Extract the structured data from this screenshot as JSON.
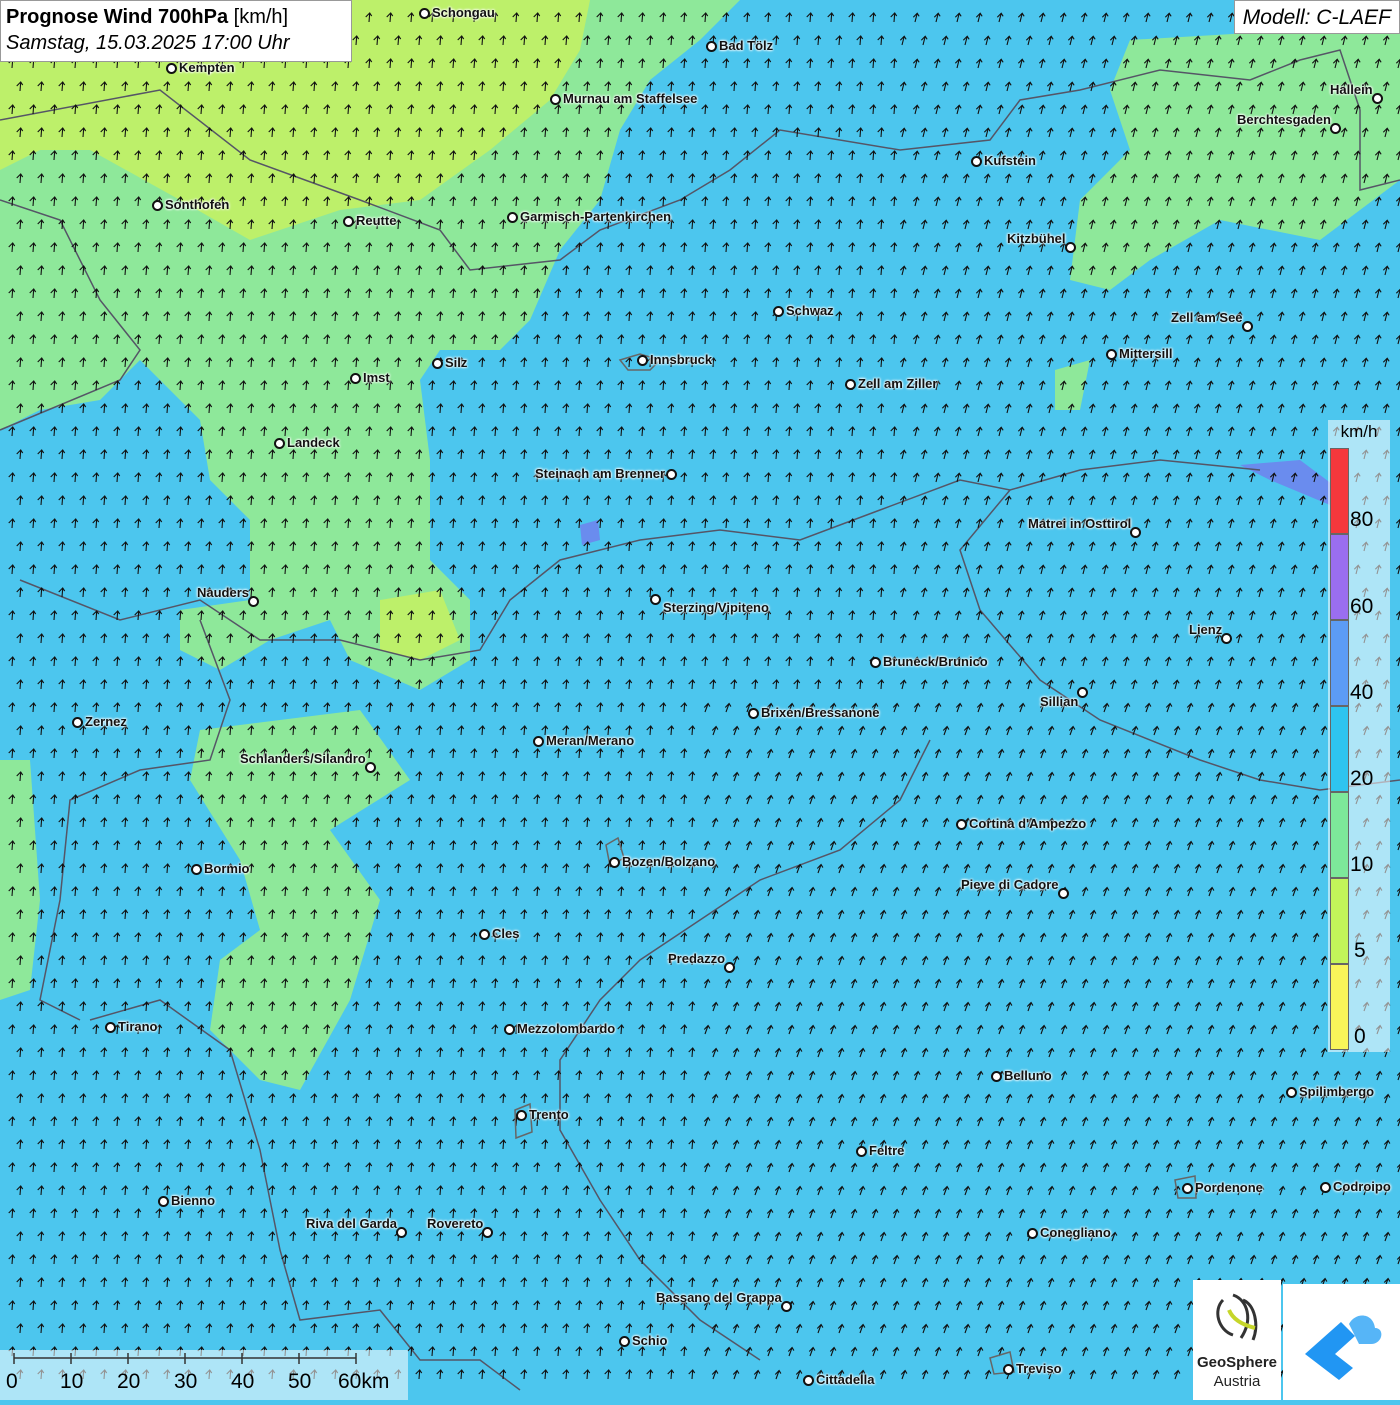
{
  "header": {
    "title_bold": "Prognose Wind 700hPa",
    "title_unit": "[km/h]",
    "datetime": "Samstag, 15.03.2025 17:00 Uhr"
  },
  "model": "Modell: C-LAEF",
  "legend": {
    "unit": "km/h",
    "ticks": [
      "80",
      "60",
      "40",
      "20",
      "10",
      "5",
      "0"
    ],
    "colors": [
      "#f5383c",
      "#9a6ef0",
      "#5c9cf5",
      "#2ec4f0",
      "#7de89a",
      "#c2f55a",
      "#f9f55a"
    ]
  },
  "scalebar": {
    "labels": [
      "0",
      "10",
      "20",
      "30",
      "40",
      "50",
      "60km"
    ]
  },
  "logos": {
    "geosphere_line1": "GeoSphere",
    "geosphere_line2": "Austria"
  },
  "colors": {
    "sea_blue": "#4cc6ee",
    "green": "#8ee89a",
    "yellowgreen": "#bdf06a",
    "border": "#555566"
  },
  "cities": [
    {
      "name": "Schongau"
    },
    {
      "name": "Bad Tölz"
    },
    {
      "name": "Kempten"
    },
    {
      "name": "Murnau am Staffelsee"
    },
    {
      "name": "Hallein"
    },
    {
      "name": "Berchtesgaden"
    },
    {
      "name": "Kufstein"
    },
    {
      "name": "Sonthofen"
    },
    {
      "name": "Reutte"
    },
    {
      "name": "Garmisch-Partenkirchen"
    },
    {
      "name": "Kitzbühel"
    },
    {
      "name": "Schwaz"
    },
    {
      "name": "Zell am See"
    },
    {
      "name": "Mittersill"
    },
    {
      "name": "Silz"
    },
    {
      "name": "Innsbruck"
    },
    {
      "name": "Imst"
    },
    {
      "name": "Zell am Ziller"
    },
    {
      "name": "Landeck"
    },
    {
      "name": "Steinach am Brenner"
    },
    {
      "name": "Matrei in Osttirol"
    },
    {
      "name": "Nauders"
    },
    {
      "name": "Sterzing/Vipiteno"
    },
    {
      "name": "Lienz"
    },
    {
      "name": "Bruneck/Brunico"
    },
    {
      "name": "Sillian"
    },
    {
      "name": "Brixen/Bressanone"
    },
    {
      "name": "Zernez"
    },
    {
      "name": "Meran/Merano"
    },
    {
      "name": "Schlanders/Silandro"
    },
    {
      "name": "Cortina d'Ampezzo"
    },
    {
      "name": "Bozen/Bolzano"
    },
    {
      "name": "Bormio"
    },
    {
      "name": "Pieve di Cadore"
    },
    {
      "name": "Cles"
    },
    {
      "name": "Predazzo"
    },
    {
      "name": "Tirano"
    },
    {
      "name": "Mezzolombardo"
    },
    {
      "name": "Belluno"
    },
    {
      "name": "Spilimbergo"
    },
    {
      "name": "Trento"
    },
    {
      "name": "Feltre"
    },
    {
      "name": "Pordenone"
    },
    {
      "name": "Codroipo"
    },
    {
      "name": "Bienno"
    },
    {
      "name": "Riva del Garda"
    },
    {
      "name": "Rovereto"
    },
    {
      "name": "Conegliano"
    },
    {
      "name": "Bassano del Grappa"
    },
    {
      "name": "Schio"
    },
    {
      "name": "Treviso"
    },
    {
      "name": "Cittadella"
    }
  ]
}
